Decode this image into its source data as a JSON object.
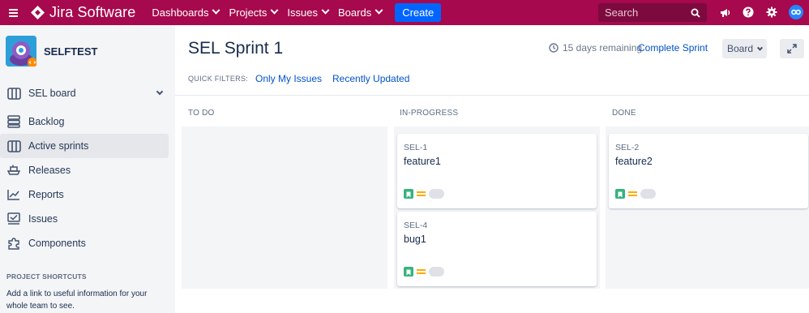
{
  "topbar": {
    "app_name": "Jira Software",
    "nav": [
      {
        "label": "Dashboards"
      },
      {
        "label": "Projects"
      },
      {
        "label": "Issues"
      },
      {
        "label": "Boards"
      }
    ],
    "create_label": "Create",
    "search_placeholder": "Search",
    "icons": [
      "menu-icon",
      "jira-logo-icon",
      "search-icon",
      "notifications-icon",
      "help-icon",
      "settings-icon",
      "profile-icon"
    ],
    "colors": {
      "bar": "#a6094d",
      "create": "#0065ff",
      "search_bg": "#7d0a3e"
    }
  },
  "sidebar": {
    "project_name": "SELFTEST",
    "board_label": "SEL board",
    "items": [
      {
        "label": "Backlog",
        "icon": "backlog-icon"
      },
      {
        "label": "Active sprints",
        "icon": "board-icon",
        "active": true
      },
      {
        "label": "Releases",
        "icon": "ship-icon"
      },
      {
        "label": "Reports",
        "icon": "chart-icon"
      },
      {
        "label": "Issues",
        "icon": "issues-icon"
      },
      {
        "label": "Components",
        "icon": "puzzle-icon"
      }
    ],
    "shortcuts_title": "PROJECT SHORTCUTS",
    "shortcuts_desc": "Add a link to useful information for your whole team to see."
  },
  "main": {
    "title": "SEL Sprint 1",
    "remaining": "15 days remaining",
    "complete_label": "Complete Sprint",
    "board_button": "Board",
    "quick_filters_label": "QUICK FILTERS:",
    "quick_filters": [
      "Only My Issues",
      "Recently Updated"
    ],
    "columns": [
      {
        "name": "TO DO",
        "cards": []
      },
      {
        "name": "IN-PROGRESS",
        "cards": [
          {
            "key": "SEL-1",
            "summary": "feature1"
          },
          {
            "key": "SEL-4",
            "summary": "bug1"
          }
        ]
      },
      {
        "name": "DONE",
        "cards": [
          {
            "key": "SEL-2",
            "summary": "feature2"
          }
        ]
      }
    ]
  }
}
